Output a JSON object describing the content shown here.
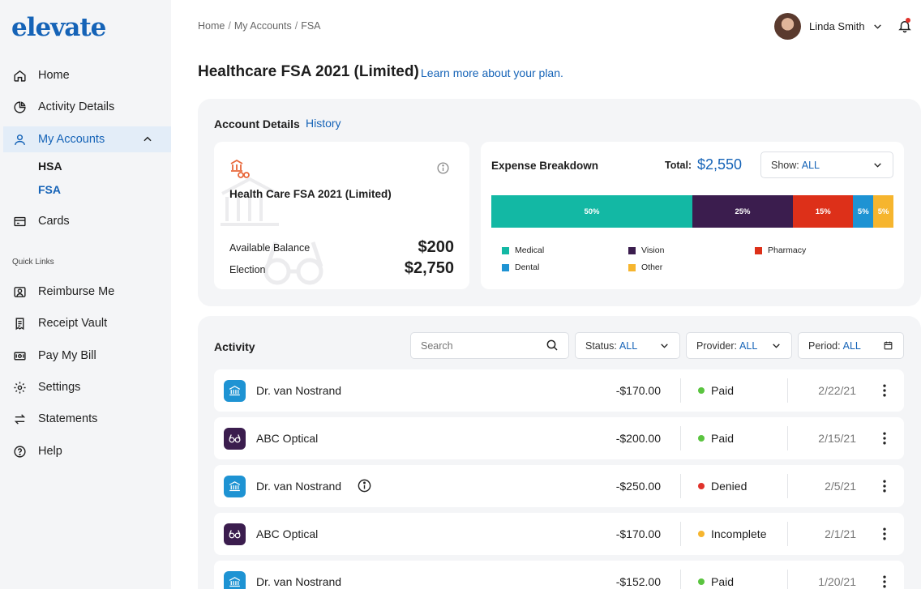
{
  "brand": {
    "name": "elevate",
    "color": "#1563b7"
  },
  "nav": {
    "items": [
      {
        "label": "Home",
        "icon": "home-icon"
      },
      {
        "label": "Activity Details",
        "icon": "pie-chart-icon"
      },
      {
        "label": "My Accounts",
        "icon": "user-icon",
        "active": true,
        "expanded": true
      },
      {
        "label": "Cards",
        "icon": "card-icon"
      }
    ],
    "sub_items": [
      {
        "label": "HSA",
        "active": false
      },
      {
        "label": "FSA",
        "active": true
      }
    ],
    "quick_links_label": "Quick Links",
    "quick_links": [
      {
        "label": "Reimburse Me",
        "icon": "money-user-icon"
      },
      {
        "label": "Receipt Vault",
        "icon": "receipt-icon"
      },
      {
        "label": "Pay My Bill",
        "icon": "bill-icon"
      },
      {
        "label": "Settings",
        "icon": "gear-icon"
      },
      {
        "label": "Statements",
        "icon": "arrows-swap-icon"
      },
      {
        "label": "Help",
        "icon": "help-icon"
      }
    ]
  },
  "breadcrumb": [
    "Home",
    "My Accounts",
    "FSA"
  ],
  "user": {
    "name": "Linda Smith",
    "has_notification": true
  },
  "page": {
    "title": "Healthcare FSA 2021 (Limited)",
    "learn_link": "Learn more about your plan."
  },
  "account_details": {
    "title": "Account Details",
    "history_link": "History",
    "card": {
      "name": "Health Care FSA 2021 (Limited)",
      "available_label": "Available Balance",
      "available_value": "$200",
      "election_label": "Election",
      "election_value": "$2,750"
    }
  },
  "expense": {
    "title": "Expense Breakdown",
    "total_label": "Total:",
    "total_value": "$2,550",
    "show_label": "Show:",
    "show_value": "ALL"
  },
  "chart_data": {
    "type": "bar",
    "categories": [
      "Medical",
      "Vision",
      "Pharmacy",
      "Dental",
      "Other"
    ],
    "values": [
      50,
      25,
      15,
      5,
      5
    ],
    "labels": [
      "50%",
      "25%",
      "15%",
      "5%",
      "5%"
    ],
    "colors": [
      "#13b8a4",
      "#3b1d4e",
      "#dd3019",
      "#1e93d3",
      "#f6b52e"
    ],
    "stacked": true,
    "orientation": "horizontal",
    "legend": [
      "Medical",
      "Vision",
      "Pharmacy",
      "Dental",
      "Other"
    ],
    "legend_placement": "bottom"
  },
  "activity": {
    "title": "Activity",
    "search_placeholder": "Search",
    "filters": [
      {
        "label": "Status:",
        "value": "ALL"
      },
      {
        "label": "Provider:",
        "value": "ALL"
      },
      {
        "label": "Period:",
        "value": "ALL"
      }
    ],
    "rows": [
      {
        "name": "Dr. van Nostrand",
        "type": "medical",
        "amount": "-$170.00",
        "status": "Paid",
        "status_color": "#5ac43f",
        "date": "2/22/21",
        "info": false
      },
      {
        "name": "ABC Optical",
        "type": "vision",
        "amount": "-$200.00",
        "status": "Paid",
        "status_color": "#5ac43f",
        "date": "2/15/21",
        "info": false
      },
      {
        "name": "Dr. van Nostrand",
        "type": "medical",
        "amount": "-$250.00",
        "status": "Denied",
        "status_color": "#e0322b",
        "date": "2/5/21",
        "info": true
      },
      {
        "name": "ABC Optical",
        "type": "vision",
        "amount": "-$170.00",
        "status": "Incomplete",
        "status_color": "#f6b52e",
        "date": "2/1/21",
        "info": false
      },
      {
        "name": "Dr. van Nostrand",
        "type": "medical",
        "amount": "-$152.00",
        "status": "Paid",
        "status_color": "#5ac43f",
        "date": "1/20/21",
        "info": false
      }
    ],
    "type_colors": {
      "medical": "#1e93d3",
      "vision": "#3b1d4e"
    }
  }
}
